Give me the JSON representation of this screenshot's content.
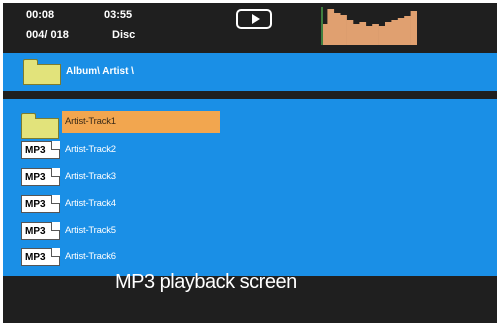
{
  "status": {
    "elapsed_time": "00:08",
    "total_time": "03:55",
    "track_counter": "004/ 018",
    "source_mode": "Disc",
    "play_state_icon": "play-icon",
    "spectrum_levels": [
      0.55,
      0.95,
      0.85,
      0.8,
      0.65,
      0.55,
      0.6,
      0.5,
      0.55,
      0.5,
      0.6,
      0.65,
      0.7,
      0.75,
      0.9
    ],
    "spectrum_color": "#e0a070"
  },
  "path": {
    "folder_icon": "folder-icon",
    "text": "Album\\ Artist \\"
  },
  "file_list": {
    "parent_folder_icon": "folder-icon",
    "selected_index": 0,
    "items": [
      {
        "type": "mp3",
        "badge": "MP3",
        "label": "Artist-Track1"
      },
      {
        "type": "mp3",
        "badge": "MP3",
        "label": "Artist-Track2"
      },
      {
        "type": "mp3",
        "badge": "MP3",
        "label": "Artist-Track3"
      },
      {
        "type": "mp3",
        "badge": "MP3",
        "label": "Artist-Track4"
      },
      {
        "type": "mp3",
        "badge": "MP3",
        "label": "Artist-Track5"
      },
      {
        "type": "mp3",
        "badge": "MP3",
        "label": "Artist-Track6"
      }
    ]
  },
  "caption": "MP3 playback screen",
  "colors": {
    "screen_background": "#1f1f1f",
    "list_blue": "#1a8fe6",
    "selection_orange": "#f2a64f",
    "folder_yellow": "#e2e37b"
  }
}
